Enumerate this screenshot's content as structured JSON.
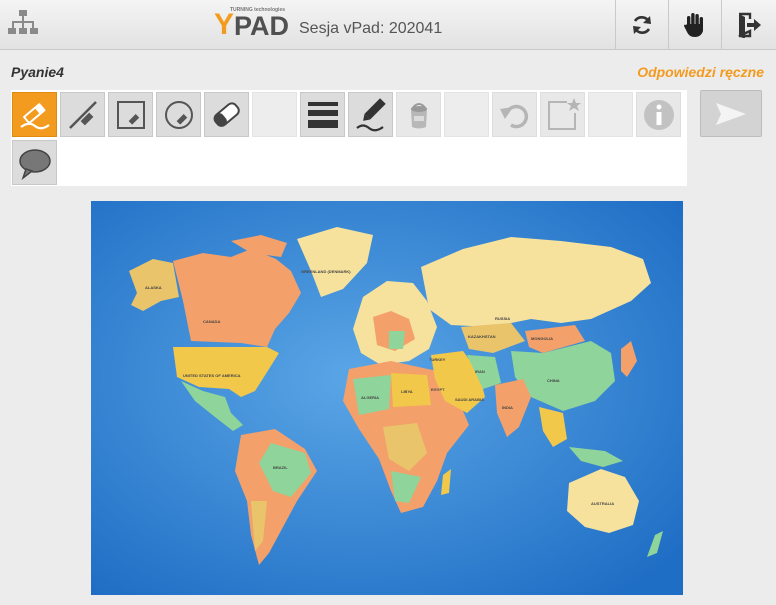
{
  "header": {
    "logo_small": "TURNING technologies",
    "logo_y": "Y",
    "logo_pad": "PAD",
    "session_label": "Sesja vPad: 202041"
  },
  "header_icons": [
    "network-icon",
    "refresh-icon",
    "hand-raise-icon",
    "exit-icon"
  ],
  "question": {
    "title": "Pyanie4",
    "answer_mode": "Odpowiedzi ręczne"
  },
  "tools": [
    {
      "name": "pen-icon",
      "state": "active"
    },
    {
      "name": "line-icon",
      "state": "normal"
    },
    {
      "name": "rectangle-icon",
      "state": "normal"
    },
    {
      "name": "circle-icon",
      "state": "normal"
    },
    {
      "name": "eraser-icon",
      "state": "normal"
    },
    {
      "name": "line-width-icon",
      "state": "normal"
    },
    {
      "name": "pen-color-icon",
      "state": "normal"
    },
    {
      "name": "fill-bucket-icon",
      "state": "disabled"
    },
    {
      "name": "undo-icon",
      "state": "disabled"
    },
    {
      "name": "add-note-icon",
      "state": "disabled"
    },
    {
      "name": "info-icon",
      "state": "disabled"
    },
    {
      "name": "comment-icon",
      "state": "normal"
    }
  ],
  "send_icon": "send-icon",
  "colors": {
    "accent": "#f29b1f",
    "ocean": "#2f7fd0",
    "toolbar_bg": "#dcdcdc"
  },
  "map": {
    "labels": {
      "greenland": "GREENLAND (DENMARK)",
      "alaska": "ALASKA",
      "canada": "CANADA",
      "usa": "UNITED STATES OF AMERICA",
      "russia": "RUSSIA",
      "kazakhstan": "KAZAKHSTAN",
      "mongolia": "MONGOLIA",
      "china": "CHINA",
      "india": "INDIA",
      "algeria": "ALGERIA",
      "libya": "LIBYA",
      "egypt": "EGYPT",
      "saudi": "SAUDI ARABIA",
      "turkey": "TURKEY",
      "brazil": "BRAZIL",
      "australia": "AUSTRALIA",
      "iran": "IRAN"
    }
  }
}
